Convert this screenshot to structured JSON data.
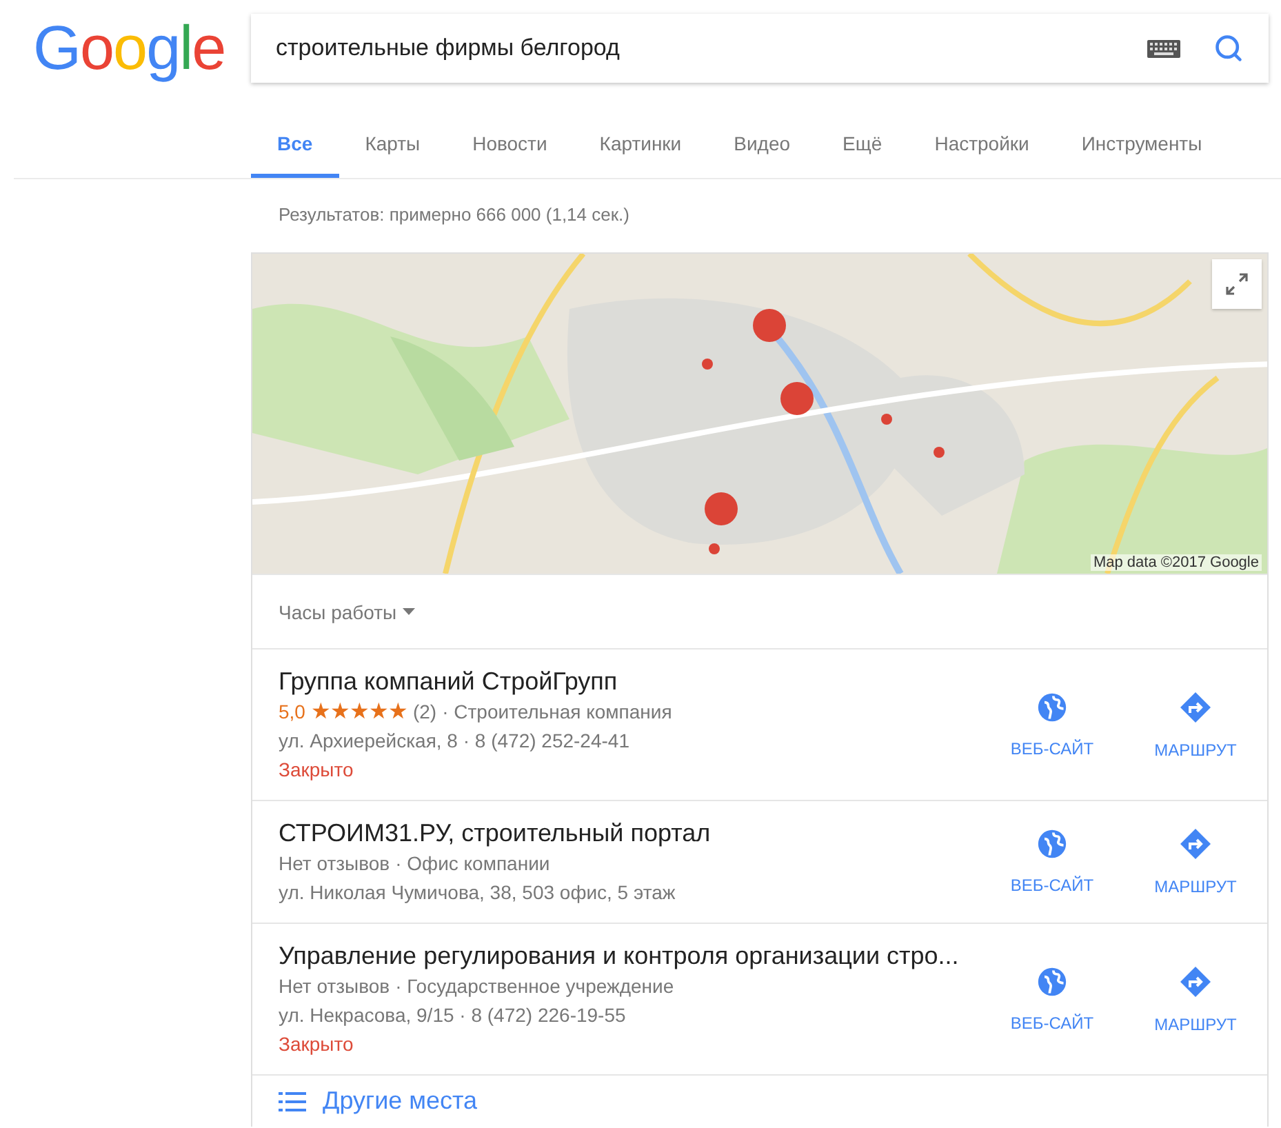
{
  "logo": "Google",
  "search": {
    "value": "строительные фирмы белгород"
  },
  "tabs": [
    {
      "label": "Все",
      "selected": true
    },
    {
      "label": "Карты",
      "selected": false
    },
    {
      "label": "Новости",
      "selected": false
    },
    {
      "label": "Картинки",
      "selected": false
    },
    {
      "label": "Видео",
      "selected": false
    },
    {
      "label": "Ещё",
      "selected": false
    },
    {
      "label": "Настройки",
      "selected": false
    },
    {
      "label": "Инструменты",
      "selected": false
    }
  ],
  "result_stats": "Результатов: примерно 666 000 (1,14 сек.)",
  "map": {
    "kind": "picture",
    "attribution": "Map data ©2017 Google"
  },
  "hours_filter": "Часы работы",
  "places": [
    {
      "name": "Группа компаний СтройГрупп",
      "rating": "5,0",
      "stars": 5,
      "reviews": "(2)",
      "category": "· Строительная компания",
      "address": "ул. Архиерейская, 8 · 8 (472) 252-24-41",
      "hours": "Закрыто",
      "website": "ВЕБ-САЙТ",
      "route": "МАРШРУТ"
    },
    {
      "name": "СТРОИМ31.РУ, строительный портал",
      "reviews_text": "Нет отзывов",
      "category": "· Офис компании",
      "address": "ул. Николая Чумичова, 38, 503 офис, 5 этаж",
      "website": "ВЕБ-САЙТ",
      "route": "МАРШРУТ"
    },
    {
      "name": "Управление регулирования и контроля организации стро...",
      "reviews_text": "Нет отзывов",
      "category": "· Государственное учреждение",
      "address": "ул. Некрасова, 9/15 · 8 (472) 226-19-55",
      "hours": "Закрыто",
      "website": "ВЕБ-САЙТ",
      "route": "МАРШРУТ"
    }
  ],
  "more_places": "Другие места"
}
